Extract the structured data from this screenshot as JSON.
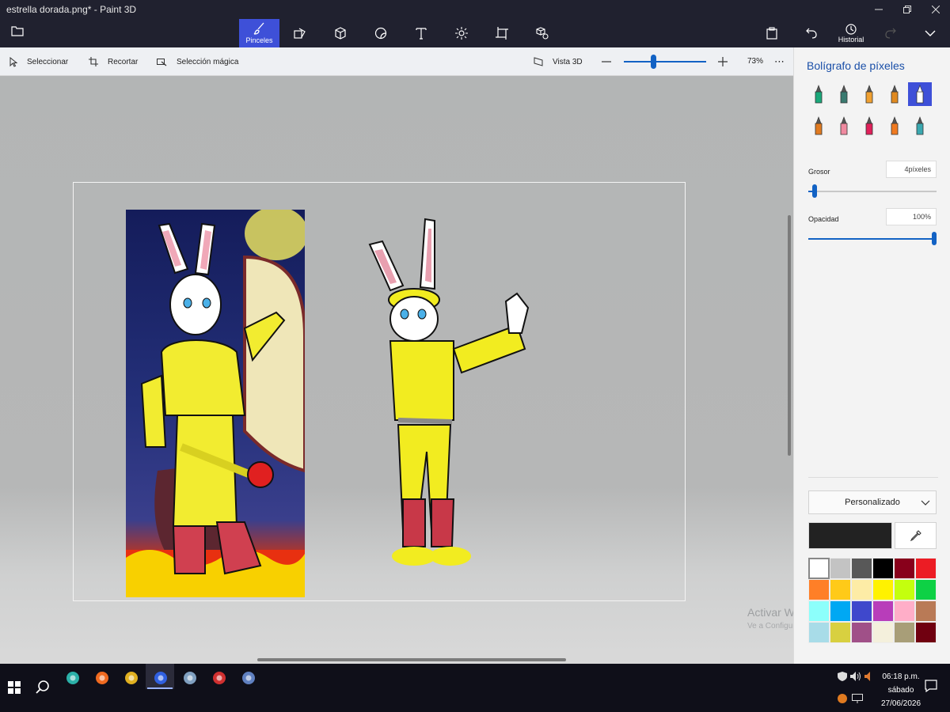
{
  "window": {
    "title": "estrella dorada.png* - Paint 3D",
    "minimize_icon": "minimize-icon",
    "restore_icon": "restore-icon",
    "close_icon": "close-icon"
  },
  "toolbar": {
    "menu_icon": "folder-icon",
    "tools": [
      {
        "name": "brushes",
        "label": "Pinceles",
        "icon": "brush-icon",
        "active": true
      },
      {
        "name": "2d-shapes",
        "label": "",
        "icon": "shapes-icon",
        "active": false
      },
      {
        "name": "3d-shapes",
        "label": "",
        "icon": "cube-icon",
        "active": false
      },
      {
        "name": "stickers",
        "label": "",
        "icon": "sticker-icon",
        "active": false
      },
      {
        "name": "text",
        "label": "",
        "icon": "text-icon",
        "active": false
      },
      {
        "name": "effects",
        "label": "",
        "icon": "sun-icon",
        "active": false
      },
      {
        "name": "canvas",
        "label": "",
        "icon": "crop-icon",
        "active": false
      },
      {
        "name": "3d-library",
        "label": "",
        "icon": "library-icon",
        "active": false
      }
    ],
    "paste_icon": "paste-icon",
    "undo_icon": "undo-icon",
    "history_label": "Historial",
    "redo_icon": "redo-icon",
    "expand_icon": "chevron-down-icon"
  },
  "subbar": {
    "select_label": "Seleccionar",
    "crop_label": "Recortar",
    "magic_select_label": "Selección mágica",
    "view3d_label": "Vista 3D",
    "zoom_percent": "73%",
    "zoom_level": 0.73,
    "more_label": "⋯"
  },
  "panel": {
    "title": "Bolígrafo de píxeles",
    "brushes": [
      {
        "name": "marker",
        "icon": "marker-icon",
        "color": "#1aa87a",
        "selected": false
      },
      {
        "name": "calligraphy-pen",
        "icon": "calligraphy-pen-icon",
        "color": "#3a7a70",
        "selected": false
      },
      {
        "name": "oil-brush",
        "icon": "oil-brush-icon",
        "color": "#f0a030",
        "selected": false
      },
      {
        "name": "watercolor",
        "icon": "watercolor-icon",
        "color": "#e08a20",
        "selected": false
      },
      {
        "name": "pixel-pen",
        "icon": "pixel-pen-icon",
        "color": "#ffffff",
        "selected": true
      },
      {
        "name": "pencil",
        "icon": "pencil-icon",
        "color": "#e07a20",
        "selected": false
      },
      {
        "name": "eraser",
        "icon": "eraser-icon",
        "color": "#f08aa0",
        "selected": false
      },
      {
        "name": "crayon",
        "icon": "crayon-icon",
        "color": "#e0205a",
        "selected": false
      },
      {
        "name": "spray-can",
        "icon": "spray-can-icon",
        "color": "#f07a20",
        "selected": false
      },
      {
        "name": "fill",
        "icon": "fill-bucket-icon",
        "color": "#3aa8b0",
        "selected": false
      }
    ],
    "thickness_label": "Grosor",
    "thickness_value": "4píxeles",
    "thickness_fraction": 0.03,
    "opacity_label": "Opacidad",
    "opacity_value": "100%",
    "opacity_fraction": 1.0,
    "color_mode": "Personalizado",
    "current_color": "#222222",
    "eyedropper_icon": "eyedropper-icon",
    "palette": [
      "#ffffff",
      "#c3c3c3",
      "#585858",
      "#000000",
      "#88001b",
      "#ec1c24",
      "#ff7f27",
      "#ffca18",
      "#fdeca6",
      "#fff200",
      "#c4ff0e",
      "#0ed145",
      "#8cfffb",
      "#00a8f3",
      "#3f48cc",
      "#b83dba",
      "#ffaec8",
      "#b97a56",
      "#a8dce8",
      "#d8d040",
      "#a05088",
      "#f4f0dc",
      "#a89e78",
      "#700010"
    ]
  },
  "watermark": {
    "line1": "Activar Windows",
    "line2": "Ve a Configuración para activar Windows."
  },
  "taskbar": {
    "start_icon": "windows-start-icon",
    "search_icon": "search-icon",
    "apps": [
      {
        "name": "edge",
        "icon": "edge-icon",
        "color": "#2bb0a8"
      },
      {
        "name": "firefox",
        "icon": "firefox-icon",
        "color": "#f06a20"
      },
      {
        "name": "chrome",
        "icon": "chrome-icon",
        "color": "#e0b020"
      },
      {
        "name": "paint-3d",
        "icon": "paint3d-icon",
        "color": "#3060e0",
        "active": true
      },
      {
        "name": "paint",
        "icon": "paint-palette-icon",
        "color": "#80a0c0"
      },
      {
        "name": "snip",
        "icon": "app-icon",
        "color": "#d03030"
      },
      {
        "name": "network-app",
        "icon": "computer-icon",
        "color": "#6080c0"
      }
    ],
    "time": "06:18 p.m.",
    "day": "sábado",
    "date": "27/06/2026"
  }
}
